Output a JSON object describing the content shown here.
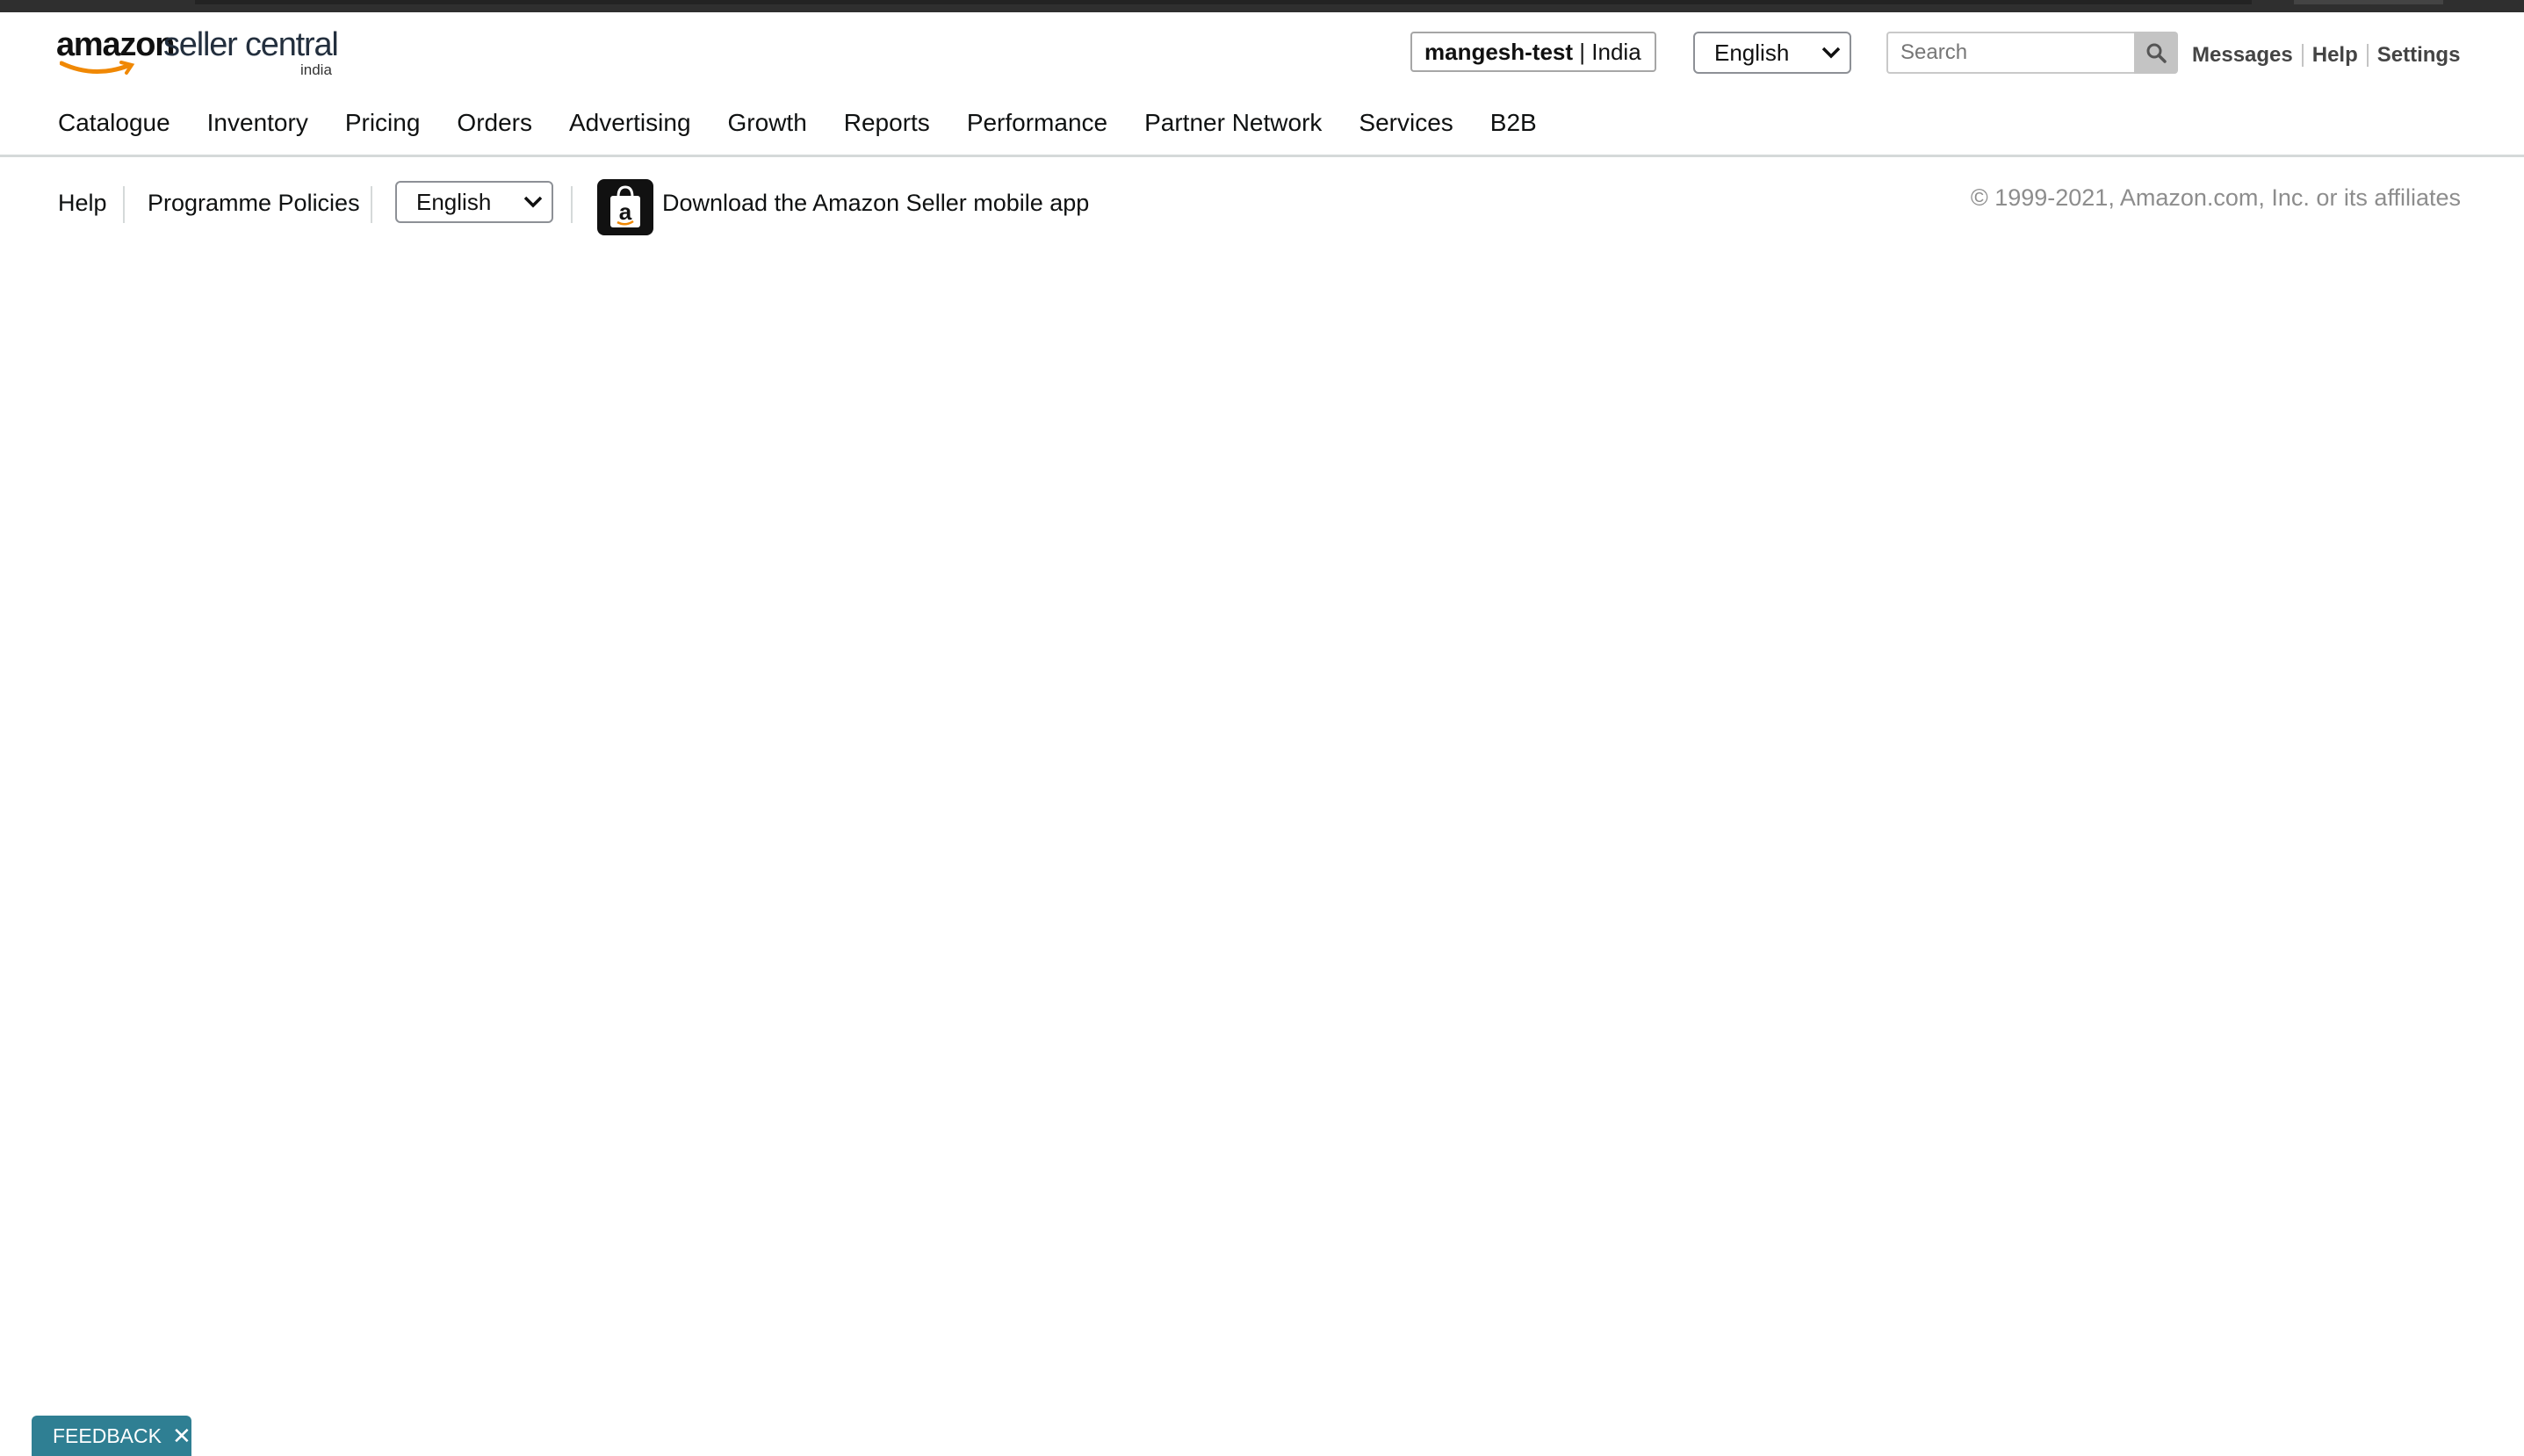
{
  "header": {
    "logo": {
      "brand": "amazon",
      "product": "seller central",
      "region": "india"
    },
    "account": {
      "name": "mangesh-test",
      "separator": "|",
      "marketplace": "India"
    },
    "language_select": {
      "value": "English"
    },
    "search": {
      "placeholder": "Search"
    },
    "links": {
      "messages": "Messages",
      "help": "Help",
      "settings": "Settings"
    }
  },
  "nav": {
    "items": [
      "Catalogue",
      "Inventory",
      "Pricing",
      "Orders",
      "Advertising",
      "Growth",
      "Reports",
      "Performance",
      "Partner Network",
      "Services",
      "B2B"
    ]
  },
  "footer": {
    "help": "Help",
    "policies": "Programme Policies",
    "language_select": {
      "value": "English"
    },
    "app_link": "Download the Amazon Seller mobile app",
    "copyright": "© 1999-2021, Amazon.com, Inc. or its affiliates"
  },
  "feedback": {
    "label": "FEEDBACK",
    "close": "✕"
  },
  "colors": {
    "feedback_bg": "#2f7f93",
    "search_button_bg": "#c4c4c4",
    "copyright_text": "#8d8d8d"
  }
}
